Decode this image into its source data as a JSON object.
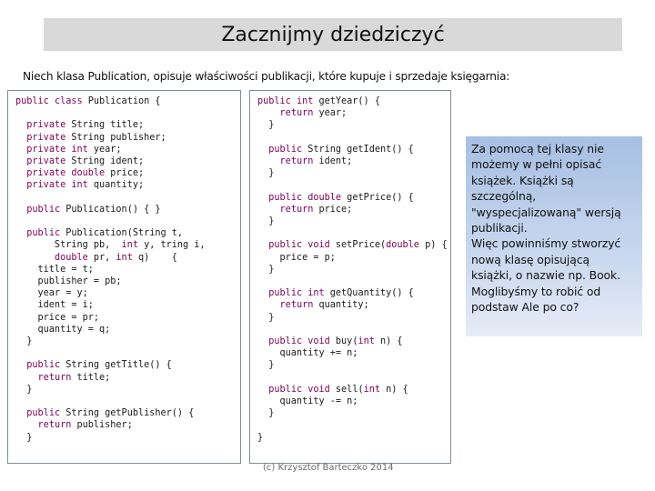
{
  "slide": {
    "title": "Zacznijmy dziedziczyć",
    "subtitle": "Niech klasa Publication, opisuje właściwości publikacji, które kupuje i sprzedaje księgarnia:",
    "footer": "(c) Krzysztof Barteczko 2014"
  },
  "code_left": {
    "lines": [
      "public class Publication {",
      "",
      "  private String title;",
      "  private String publisher;",
      "  private int year;",
      "  private String ident;",
      "  private double price;",
      "  private int quantity;",
      "",
      "  public Publication() { }",
      "",
      "  public Publication(String t,",
      "       String pb,  int y, tring i,",
      "       double pr, int q)    {",
      "    title = t;",
      "    publisher = pb;",
      "    year = y;",
      "    ident = i;",
      "    price = pr;",
      "    quantity = q;",
      "  }",
      "",
      "  public String getTitle() {",
      "    return title;",
      "  }",
      "",
      "  public String getPublisher() {",
      "    return publisher;",
      "  }"
    ]
  },
  "code_right": {
    "lines": [
      "public int getYear() {",
      "    return year;",
      "  }",
      "",
      "  public String getIdent() {",
      "    return ident;",
      "  }",
      "",
      "  public double getPrice() {",
      "    return price;",
      "  }",
      "",
      "  public void setPrice(double p) {",
      "    price = p;",
      "  }",
      "",
      "  public int getQuantity() {",
      "    return quantity;",
      "  }",
      "",
      "  public void buy(int n) {",
      "    quantity += n;",
      "  }",
      "",
      "  public void sell(int n) {",
      "    quantity -= n;",
      "  }",
      "",
      "}"
    ]
  },
  "callout": {
    "lines": [
      "Za pomocą tej klasy nie",
      "możemy w pełni opisać",
      "książek. Książki są",
      "szczególną,",
      "\"wyspecjalizowaną\" wersją",
      "publikacji.",
      "Więc powinniśmy stworzyć",
      "nową klasę opisującą",
      "książki, o nazwie np. Book.",
      "Moglibyśmy to robić od",
      "podstaw Ale po co?"
    ]
  }
}
